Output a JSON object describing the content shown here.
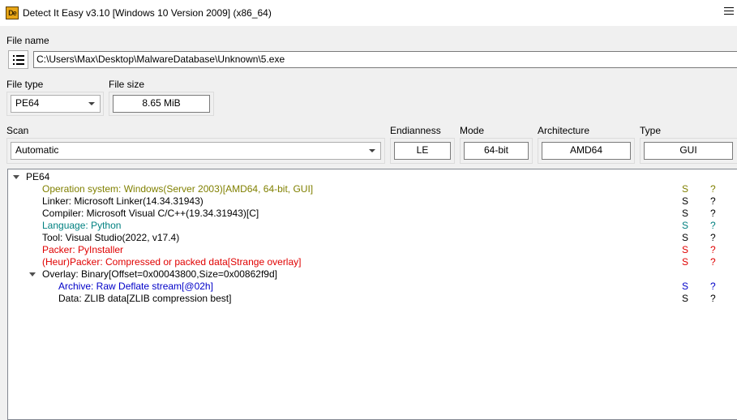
{
  "window": {
    "title": "Detect It Easy v3.10 [Windows 10 Version 2009] (x86_64)",
    "icon_text": "De"
  },
  "file_name": {
    "label": "File name",
    "value": "C:\\Users\\Max\\Desktop\\MalwareDatabase\\Unknown\\5.exe"
  },
  "file_type": {
    "label": "File type",
    "value": "PE64"
  },
  "file_size": {
    "label": "File size",
    "value": "8.65 MiB"
  },
  "scan": {
    "label": "Scan",
    "value": "Automatic"
  },
  "endianness": {
    "label": "Endianness",
    "value": "LE"
  },
  "mode": {
    "label": "Mode",
    "value": "64-bit"
  },
  "architecture": {
    "label": "Architecture",
    "value": "AMD64"
  },
  "type": {
    "label": "Type",
    "value": "GUI"
  },
  "colors": {
    "olive": "#808000",
    "teal": "#008080",
    "red": "#e00000",
    "blue": "#0000c8",
    "black": "#000000"
  },
  "results": {
    "root": "PE64",
    "rows": [
      {
        "text": "Operation system: Windows(Server 2003)[AMD64, 64-bit, GUI]",
        "color": "#808000",
        "s": "S",
        "q": "?"
      },
      {
        "text": "Linker: Microsoft Linker(14.34.31943)",
        "color": "#000000",
        "s": "S",
        "q": "?"
      },
      {
        "text": "Compiler: Microsoft Visual C/C++(19.34.31943)[C]",
        "color": "#000000",
        "s": "S",
        "q": "?"
      },
      {
        "text": "Language: Python",
        "color": "#008080",
        "s": "S",
        "q": "?"
      },
      {
        "text": "Tool: Visual Studio(2022, v17.4)",
        "color": "#000000",
        "s": "S",
        "q": "?"
      },
      {
        "text": "Packer: PyInstaller",
        "color": "#e00000",
        "s": "S",
        "q": "?"
      },
      {
        "text": "(Heur)Packer: Compressed or packed data[Strange overlay]",
        "color": "#e00000",
        "s": "S",
        "q": "?"
      },
      {
        "text": "Overlay: Binary[Offset=0x00043800,Size=0x00862f9d]",
        "color": "#000000",
        "s": "",
        "q": ""
      },
      {
        "text": "Archive: Raw Deflate stream[@02h]",
        "color": "#0000c8",
        "s": "S",
        "q": "?"
      },
      {
        "text": "Data: ZLIB data[ZLIB compression best]",
        "color": "#000000",
        "s": "S",
        "q": "?"
      }
    ]
  }
}
